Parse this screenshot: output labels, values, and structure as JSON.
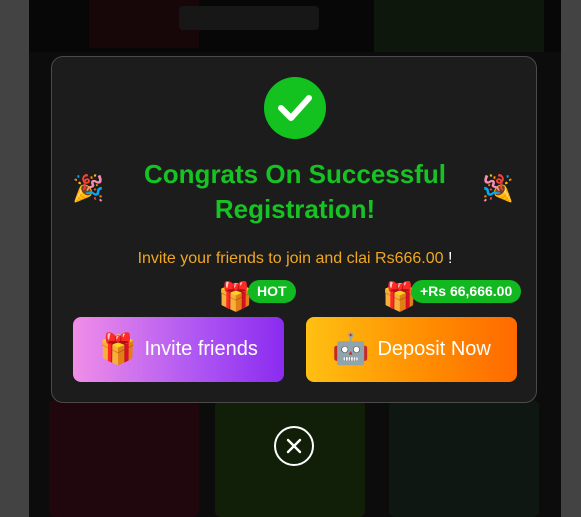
{
  "modal": {
    "title": "Congrats On Successful Registration!",
    "invite_text": "Invite your friends to join and clai Rs666.00",
    "invite_suffix": " !",
    "hot_badge": "HOT",
    "bonus_badge": "+Rs 66,666.00",
    "invite_button": "Invite friends",
    "deposit_button": "Deposit Now"
  },
  "icons": {
    "check": "checkmark-icon",
    "party": "party-popper-icon",
    "gift": "gift-icon",
    "robot": "robot-mascot-icon",
    "close": "close-icon"
  },
  "colors": {
    "success_green": "#13c21f",
    "title_green": "#16c323",
    "invite_text": "#f0a820",
    "invite_gradient_start": "#f08ee8",
    "invite_gradient_end": "#8a2bf0",
    "deposit_gradient_start": "#ffc012",
    "deposit_gradient_end": "#ff6a00",
    "modal_bg": "#1c1c1c"
  }
}
